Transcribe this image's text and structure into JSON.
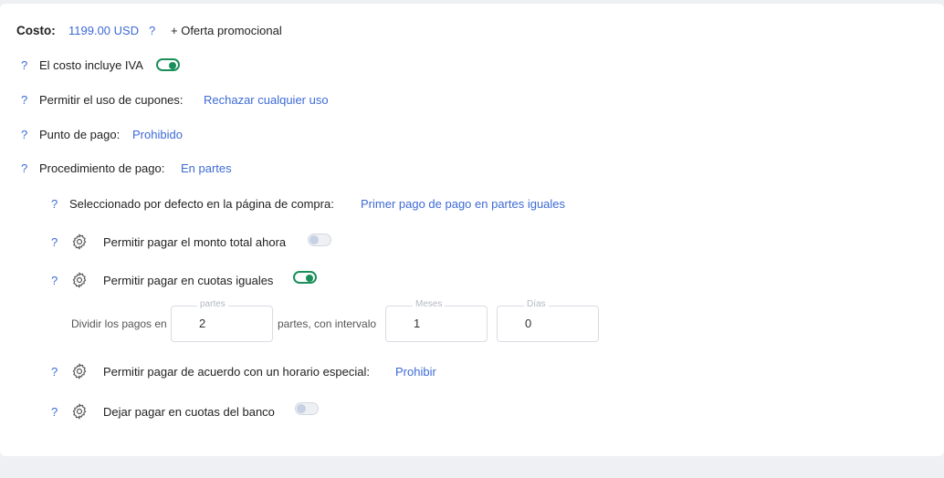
{
  "cost": {
    "label": "Costo:",
    "value": "1199.00 USD",
    "help": "?",
    "promo": "+ Oferta promocional"
  },
  "settings": {
    "vat": {
      "help": "?",
      "label": "El costo incluye IVA",
      "enabled": true
    },
    "coupons": {
      "help": "?",
      "label": "Permitir el uso de cupones:",
      "value": "Rechazar cualquier uso"
    },
    "pay_point": {
      "help": "?",
      "label": "Punto de pago:",
      "value": "Prohibido"
    },
    "procedure": {
      "help": "?",
      "label": "Procedimiento de pago:",
      "value": "En partes"
    }
  },
  "installments": {
    "default_selection": {
      "help": "?",
      "label": "Seleccionado por defecto en la página de compra:",
      "value": "Primer pago de pago en partes iguales"
    },
    "full_now": {
      "help": "?",
      "label": "Permitir pagar el monto total ahora",
      "enabled": false
    },
    "equal": {
      "help": "?",
      "label": "Permitir pagar en cuotas iguales",
      "enabled": true
    },
    "split": {
      "prefix": "Dividir los pagos en",
      "parts_legend": "partes",
      "parts_value": "2",
      "middle": "partes, con intervalo",
      "months_legend": "Meses",
      "months_value": "1",
      "days_legend": "Días",
      "days_value": "0"
    },
    "schedule": {
      "help": "?",
      "label": "Permitir pagar de acuerdo con un horario especial:",
      "value": "Prohibir"
    },
    "bank": {
      "help": "?",
      "label": "Dejar pagar en cuotas del banco",
      "enabled": false
    }
  },
  "colors": {
    "accent": "#3d6ad6",
    "toggle_on": "#1a8f5a"
  },
  "icons": {
    "gear": "gear-icon"
  }
}
